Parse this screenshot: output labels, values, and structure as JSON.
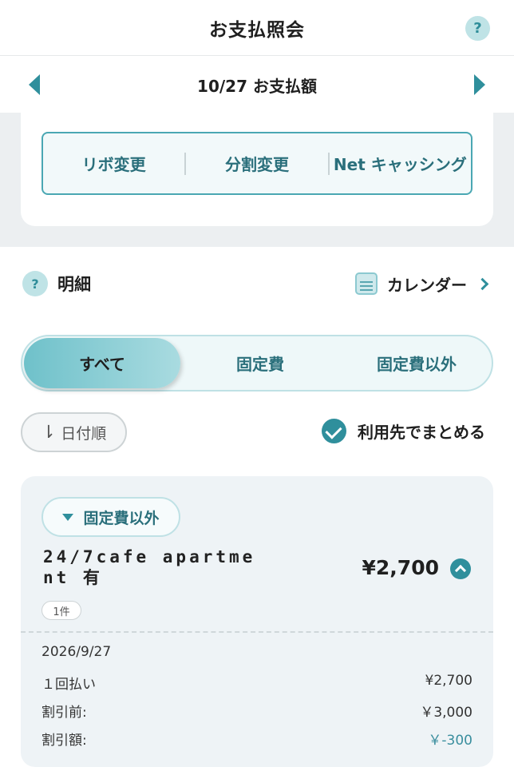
{
  "header": {
    "title": "お支払照会",
    "help": "?"
  },
  "month": {
    "title": "10/27 お支払額"
  },
  "actions": [
    "リボ変更",
    "分割変更",
    "Net キャッシング"
  ],
  "section": {
    "help": "?",
    "title": "明細",
    "calendar_label": "カレンダー"
  },
  "segments": [
    "すべて",
    "固定費",
    "固定費以外"
  ],
  "sort": {
    "label": "日付順"
  },
  "merge": {
    "label": "利用先でまとめる"
  },
  "detail": {
    "tag": "固定費以外",
    "store_line1": "24/7cafe apartme",
    "store_line2": "nt 有",
    "amount": "¥2,700",
    "count": "1件",
    "date": "2026/9/27",
    "payment_type": "１回払い",
    "payment_amount": "¥2,700",
    "before_discount_label": "割引前:",
    "before_discount_value": "￥3,000",
    "discount_label": "割引額:",
    "discount_value": "￥-300"
  },
  "colors": {
    "accent": "#2f8f9c",
    "band": "#eceff1",
    "card": "#eef3f6"
  }
}
